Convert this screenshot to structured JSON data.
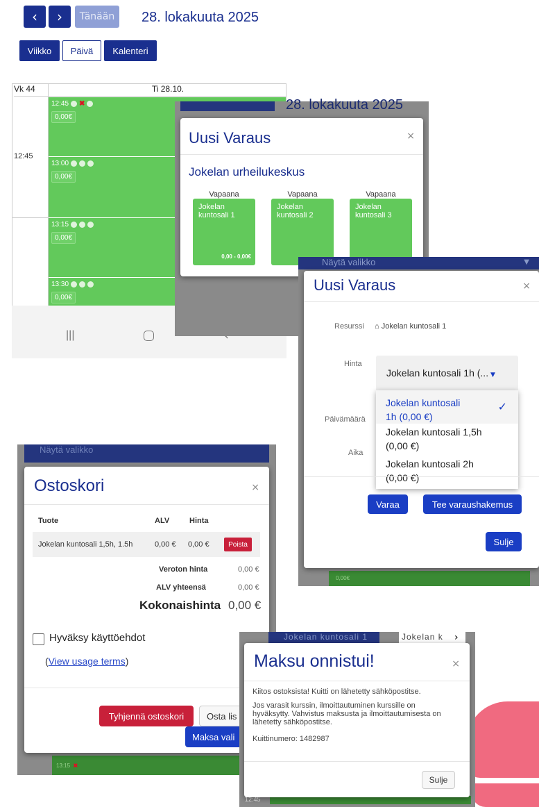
{
  "top": {
    "prev_icon": "‹",
    "next_icon": "›",
    "today": "Tänään",
    "date": "28. lokakuuta 2025"
  },
  "views": {
    "week": "Viikko",
    "day": "Päivä",
    "calendar": "Kalenteri"
  },
  "calendar": {
    "week_label": "Vk 44",
    "day_label": "Ti 28.10.",
    "time_label": "12:45",
    "slots": [
      {
        "time": "12:45",
        "price": "0,00€"
      },
      {
        "time": "13:00",
        "price": "0,00€"
      },
      {
        "time": "13:15",
        "price": "0,00€"
      },
      {
        "time": "13:30",
        "price": "0,00€"
      }
    ]
  },
  "modal1": {
    "bg_title": "28. lokakuuta 2025",
    "title": "Uusi Varaus",
    "close": "×",
    "venue": "Jokelan urheilukeskus",
    "resources": [
      {
        "status": "Vapaana",
        "name": "Jokelan kuntosali 1",
        "price": "0,00 - 0,00€"
      },
      {
        "status": "Vapaana",
        "name": "Jokelan kuntosali 2",
        "price": ""
      },
      {
        "status": "Vapaana",
        "name": "Jokelan kuntosali 3",
        "price": ""
      }
    ]
  },
  "modal2": {
    "nav_label": "Näytä valikko",
    "title": "Uusi Varaus",
    "close": "×",
    "resource_label": "Resurssi",
    "resource_icon": "home-icon",
    "resource_value": "Jokelan kuntosali 1",
    "price_label": "Hinta",
    "price_selected": "Jokelan kuntosali 1h (...",
    "date_label": "Päivämäärä",
    "time_label": "Aika",
    "options": [
      {
        "line1": "Jokelan kuntosali",
        "line2": "1h (0,00 €)",
        "checked": true
      },
      {
        "line1": "Jokelan kuntosali 1,5h",
        "line2": "(0,00 €)",
        "checked": false
      },
      {
        "line1": "Jokelan kuntosali 2h",
        "line2": "(0,00 €)",
        "checked": false
      }
    ],
    "book": "Varaa",
    "apply": "Tee varaushakemus",
    "close_btn": "Sulje",
    "bg_price": "0,00€"
  },
  "cart": {
    "nav_label": "Näytä valikko",
    "title": "Ostoskori",
    "close": "×",
    "col_product": "Tuote",
    "col_vat": "ALV",
    "col_price": "Hinta",
    "row_product": "Jokelan kuntosali 1,5h, 1.5h",
    "row_vat": "0,00 €",
    "row_price": "0,00 €",
    "remove": "Poista",
    "net_label": "Veroton hinta",
    "net_value": "0,00 €",
    "vat_label": "ALV yhteensä",
    "vat_value": "0,00 €",
    "total_label": "Kokonaishinta",
    "total_value": "0,00 €",
    "accept_terms": "Hyväksy käyttöehdot",
    "view_terms": "View usage terms",
    "clear": "Tyhjennä ostoskori",
    "buy_more": "Osta lis",
    "pay": "Maksa vali",
    "bg_time": "13:15"
  },
  "success": {
    "tab1": "Jokelan kuntosali 1",
    "tab2": "Jokelan k",
    "title": "Maksu onnistui!",
    "close": "×",
    "p1": "Kiitos ostoksista! Kuitti on lähetetty sähköpostitse.",
    "p2": "Jos varasit kurssin, ilmoittautuminen kurssille on hyväksytty. Vahvistus maksusta ja ilmoittautumisesta on lähetetty sähköpostitse.",
    "p3": "Kuittinumero: 1482987",
    "close_btn": "Sulje",
    "bg_time": "12:45"
  },
  "colors": {
    "brand": "#1a2f8f",
    "slot_green": "#62c95b",
    "danger": "#c8203a",
    "pink": "#f06a80"
  }
}
